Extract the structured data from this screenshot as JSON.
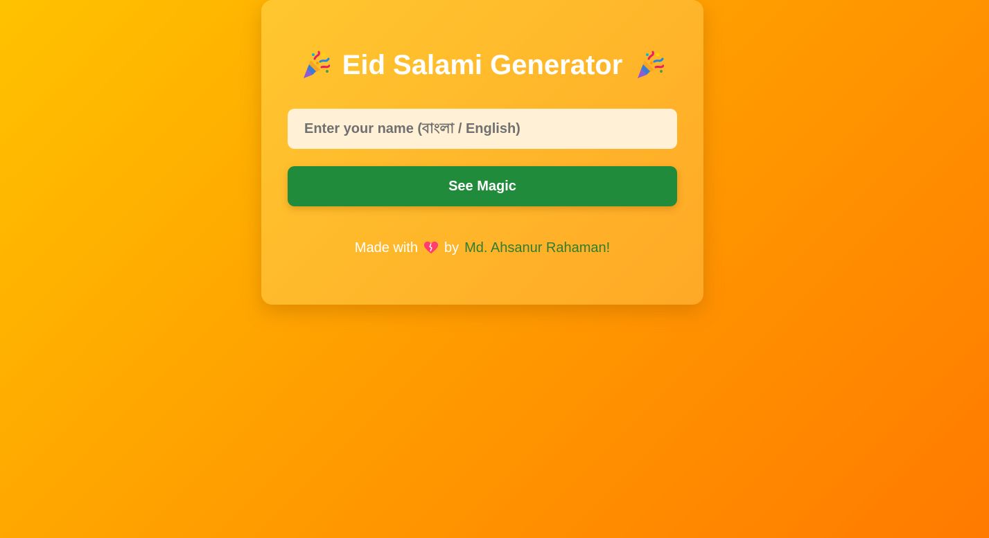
{
  "card": {
    "title": "Eid Salami Generator",
    "title_icon": "party-popper-icon"
  },
  "form": {
    "name_placeholder": "Enter your name (বাংলা / English)",
    "name_value": "",
    "submit_label": "See Magic"
  },
  "footer": {
    "prefix": "Made with",
    "heart_icon": "heart-icon",
    "by": "by",
    "author": "Md. Ahsanur Rahaman!"
  },
  "colors": {
    "background_start": "#ffc200",
    "background_end": "#ff7a00",
    "button": "#218b3c",
    "input_bg": "#fff0d6",
    "author_link": "#2e7d32",
    "heart": "#ff3d6e"
  }
}
